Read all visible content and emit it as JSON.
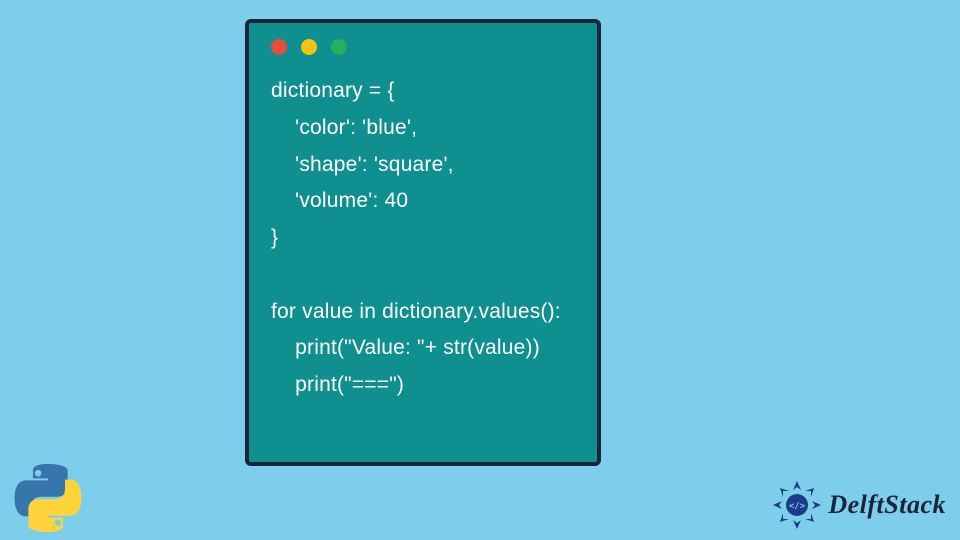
{
  "code": {
    "lines": [
      "dictionary = {",
      "    'color': 'blue',",
      "    'shape': 'square',",
      "    'volume': 40",
      "}",
      "",
      "for value in dictionary.values():",
      "    print(\"Value: \"+ str(value))",
      "    print(\"===\")"
    ]
  },
  "brand": {
    "name": "DelftStack"
  },
  "icons": {
    "python": "python-logo",
    "brand": "delftstack-logo"
  },
  "colors": {
    "bg": "#7dceeb",
    "card": "#0f8f8f",
    "border": "#19253a"
  }
}
